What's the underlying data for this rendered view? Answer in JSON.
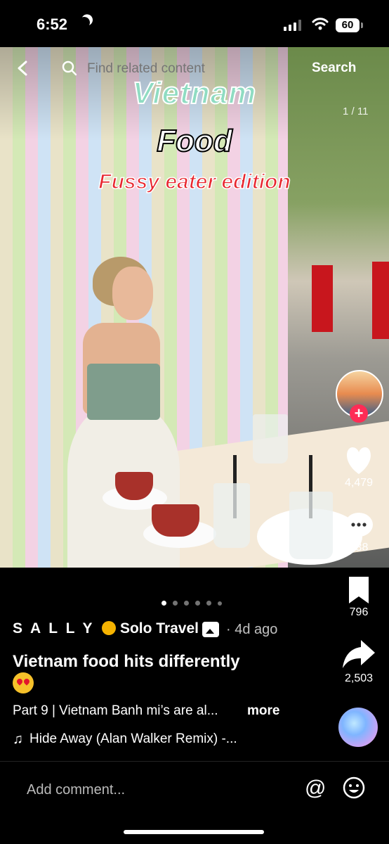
{
  "status_bar": {
    "time": "6:52",
    "battery": "60"
  },
  "top_nav": {
    "search_placeholder": "Find related content",
    "search_button": "Search"
  },
  "photo": {
    "title_line1": "Vietnam",
    "title_line2": "Food",
    "title_line3": "Fussy eater edition",
    "page_counter": "1 / 11"
  },
  "right_rail": {
    "likes": "4,479",
    "comments": "638",
    "saves": "796",
    "shares": "2,503"
  },
  "caption": {
    "author": "S A L L Y",
    "author_rest": "Solo Travel",
    "time_ago": "· 4d ago",
    "title": "Vietnam food hits differently",
    "text": "Part 9 | Vietnam Banh mi’s are al...",
    "more": "more",
    "music": "Hide Away (Alan Walker Remix) -..."
  },
  "comment_bar": {
    "placeholder": "Add comment..."
  },
  "carousel": {
    "dots": 6,
    "active_index": 0
  },
  "colors": {
    "accent": "#fe2c55",
    "background": "#000000"
  },
  "icons": [
    "back-icon",
    "search-icon",
    "heart-icon",
    "comment-icon",
    "bookmark-icon",
    "share-icon",
    "music-note-icon",
    "mention-icon",
    "emoji-icon",
    "photo-mode-icon",
    "moon-icon",
    "signal-icon",
    "wifi-icon"
  ]
}
